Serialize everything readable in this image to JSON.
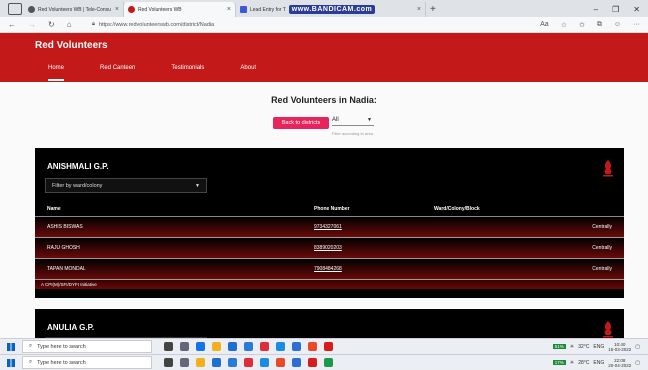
{
  "browser": {
    "tabs": [
      {
        "label": "Red Volunteers WB | Tele-Consu",
        "color": "#555555",
        "active": false
      },
      {
        "label": "Red Volunteers WB",
        "color": "#c41919",
        "active": true
      },
      {
        "label": "Lead Entry for T",
        "color": "#3b5bd6",
        "active": false
      }
    ],
    "watermark": "www.BANDICAM.com",
    "url": "https://www.redvolunteerswb.com/district/Nadia"
  },
  "site": {
    "brand": "Red Volunteers",
    "nav": [
      "Home",
      "Red Canteen",
      "Testimonials",
      "About"
    ]
  },
  "main": {
    "title": "Red Volunteers in Nadia:",
    "back_label": "Back to districts",
    "area_value": "All",
    "area_helper": "Filter according to area"
  },
  "cards": [
    {
      "title": "ANISHMALI G.P.",
      "filter_placeholder": "Filter by ward/colony",
      "columns": [
        "Name",
        "Phone Number",
        "Ward/Colony/Block"
      ],
      "rows": [
        {
          "name": "ASHIS BISWAS",
          "phone": "9734327061",
          "ward": "Centrally"
        },
        {
          "name": "RAJU GHOSH",
          "phone": "8389020203",
          "ward": "Centrally"
        },
        {
          "name": "TAPAN MONDAL",
          "phone": "7908484268",
          "ward": "Centrally"
        }
      ],
      "footnote": "A CPI(M)/SFI/DYFI Initiative"
    },
    {
      "title": "ANULIA G.P."
    }
  ],
  "taskbar": {
    "search_placeholder": "Type here to search",
    "top": {
      "temp": "32°C",
      "lang": "ENG",
      "time": "10:40",
      "date": "15-03-2022",
      "badge": "51%"
    },
    "bottom": {
      "temp": "28°C",
      "lang": "ENG",
      "time": "22:08",
      "date": "20-04-2022",
      "badge": "17%"
    }
  }
}
